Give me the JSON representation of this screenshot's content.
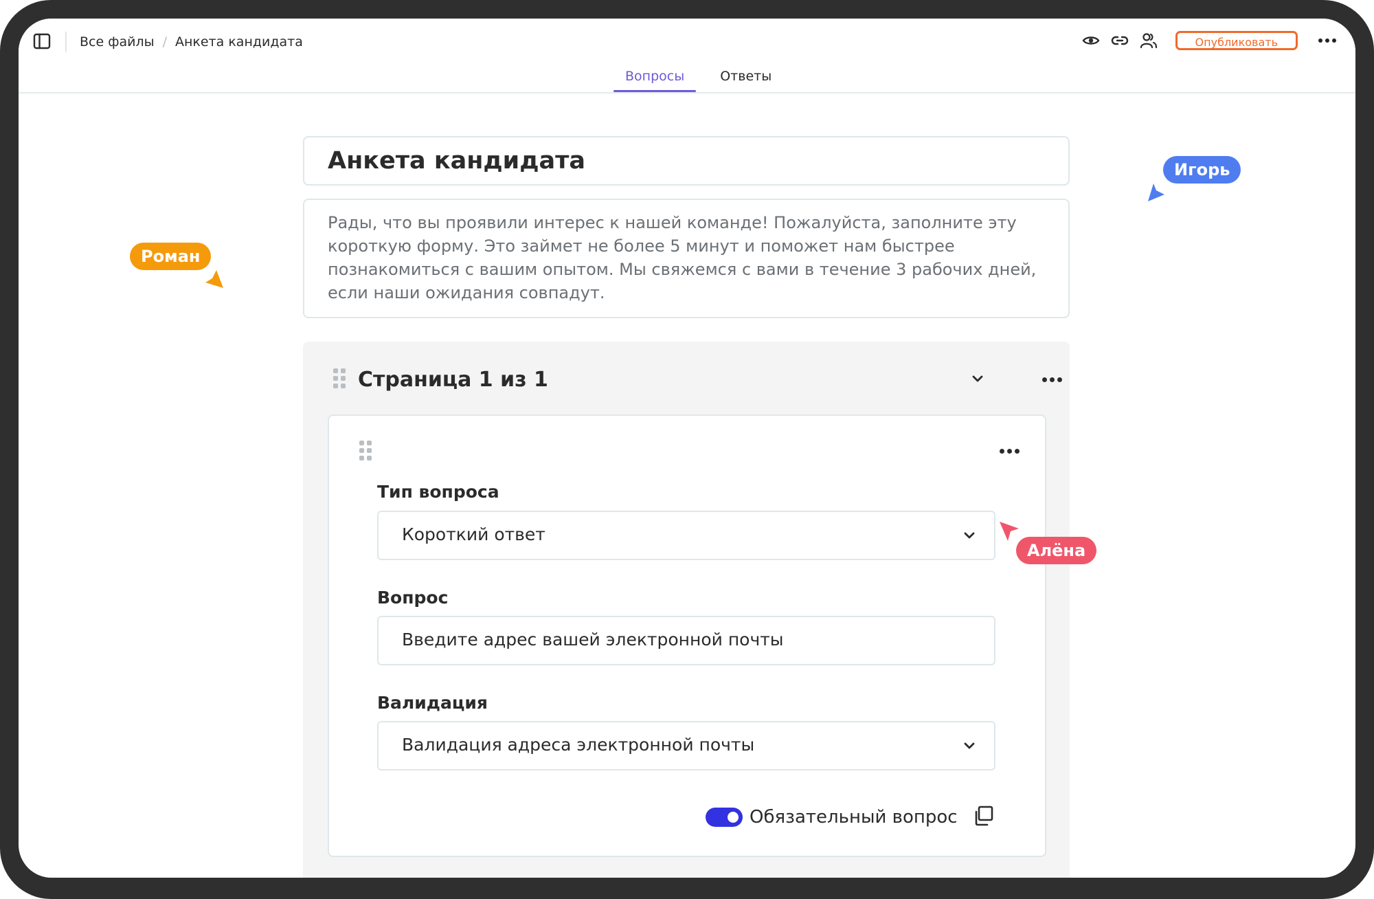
{
  "breadcrumb": {
    "root": "Все файлы",
    "separator": "/",
    "current": "Анкета кандидата"
  },
  "tabs": [
    {
      "label": "Вопросы",
      "active": true
    },
    {
      "label": "Ответы",
      "active": false
    }
  ],
  "toolbar": {
    "icons": [
      "eye-icon",
      "link-icon",
      "users-icon"
    ],
    "publish_label": "Опубликовать"
  },
  "form": {
    "title": "Анкета кандидата",
    "description": "Рады, что вы проявили интерес к нашей команде! Пожалуйста, заполните эту короткую форму. Это займет не более 5 минут и поможет нам быстрее познакомиться с вашим опытом. Мы свяжемся с вами в течение 3 рабочих дней, если наши ожидания совпадут."
  },
  "page": {
    "title": "Страница 1 из 1"
  },
  "question": {
    "type_label": "Тип вопроса",
    "type_value": "Короткий ответ",
    "question_label": "Вопрос",
    "question_value": "Введите адрес вашей электронной почты",
    "validation_label": "Валидация",
    "validation_value": "Валидация адреса электронной почты",
    "required_label": "Обязательный вопрос",
    "required": true
  },
  "collaborators": [
    {
      "name": "Игорь",
      "color": "#4f7df0"
    },
    {
      "name": "Роман",
      "color": "#f59a0a"
    },
    {
      "name": "Алёна",
      "color": "#f0566a"
    }
  ],
  "colors": {
    "accent": "#6e5ad8",
    "publish": "#f06a2a",
    "toggle": "#3232e0"
  }
}
